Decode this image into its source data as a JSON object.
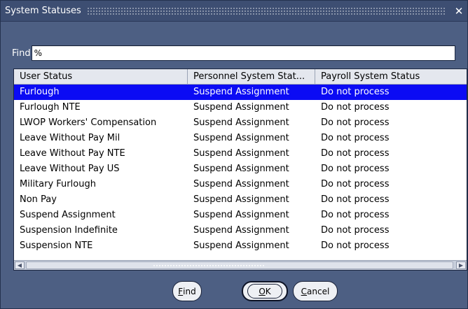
{
  "window": {
    "title": "System Statuses",
    "close_icon": "close-icon"
  },
  "find": {
    "label": "Find",
    "value": "%"
  },
  "list": {
    "columns": [
      "User Status",
      "Personnel System Stat...",
      "Payroll System Status"
    ],
    "selected_index": 0,
    "rows": [
      [
        "Furlough",
        "Suspend Assignment",
        "Do not process"
      ],
      [
        "Furlough NTE",
        "Suspend Assignment",
        "Do not process"
      ],
      [
        "LWOP Workers' Compensation",
        "Suspend Assignment",
        "Do not process"
      ],
      [
        "Leave Without Pay Mil",
        "Suspend Assignment",
        "Do not process"
      ],
      [
        "Leave Without Pay NTE",
        "Suspend Assignment",
        "Do not process"
      ],
      [
        "Leave Without Pay US",
        "Suspend Assignment",
        "Do not process"
      ],
      [
        "Military Furlough",
        "Suspend Assignment",
        "Do not process"
      ],
      [
        "Non Pay",
        "Suspend Assignment",
        "Do not process"
      ],
      [
        "Suspend Assignment",
        "Suspend Assignment",
        "Do not process"
      ],
      [
        "Suspension Indefinite",
        "Suspend Assignment",
        "Do not process"
      ],
      [
        "Suspension NTE",
        "Suspend Assignment",
        "Do not process"
      ]
    ]
  },
  "buttons": {
    "find": {
      "mnemonic": "F",
      "rest": "ind"
    },
    "ok": {
      "mnemonic": "O",
      "rest": "K"
    },
    "cancel": {
      "mnemonic": "C",
      "rest": "ancel"
    }
  },
  "colors": {
    "dialog_background": "#4d5f83",
    "selection": "#0b0bf4"
  }
}
